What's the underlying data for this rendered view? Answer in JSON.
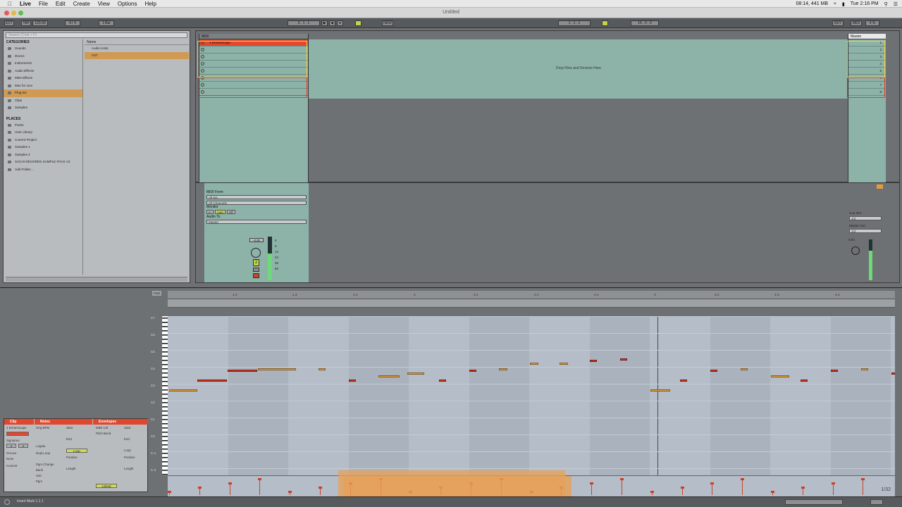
{
  "menubar": {
    "app": "Live",
    "items": [
      "File",
      "Edit",
      "Create",
      "View",
      "Options",
      "Help"
    ],
    "status_cpu": "08:14, 441 MB",
    "clock": "Tue 2:16 PM"
  },
  "window": {
    "title": "Untitled"
  },
  "transport": {
    "ext": "EXT",
    "tap": "TAP",
    "tempo": "120.00",
    "meter": "4 / 4",
    "quant": "1 Bar",
    "position": "3 . 1 . 1",
    "new": "NEW",
    "loop_start": "1 . 1 . 1",
    "loop_len": "16 . 0 . 0",
    "key": "KEY",
    "midi": "MIDI",
    "cpu": "4 %"
  },
  "browser": {
    "search_placeholder": "Search (Cmd + F)",
    "categories_title": "CATEGORIES",
    "categories": [
      "Sounds",
      "Drums",
      "Instruments",
      "Audio Effects",
      "MIDI Effects",
      "Max for Live",
      "Plug-ins",
      "Clips",
      "Samples"
    ],
    "selected_category": "Plug-ins",
    "places_title": "PLACES",
    "places": [
      "Packs",
      "User Library",
      "Current Project",
      "Samples 1",
      "Samples 2",
      "SACHI RECORDS SAMPLE PACK V2",
      "Add Folder..."
    ],
    "name_header": "Name",
    "names": [
      "Audio Units",
      "VST"
    ],
    "selected_name": "VST"
  },
  "session": {
    "track_name": "MIDI",
    "clip_name": "1 Dreamscape",
    "drop_text": "Drop Files and Devices Here",
    "master_name": "Master",
    "scenes": [
      "1",
      "2",
      "3",
      "4",
      "5",
      "6",
      "7",
      "8"
    ]
  },
  "mixer": {
    "midi_from_label": "MIDI From",
    "midi_from": "All Ins",
    "channel": "All Channels",
    "monitor_label": "Monitor",
    "monitor_in": "In",
    "monitor_auto": "Auto",
    "monitor_off": "Off",
    "audio_to_label": "Audio To",
    "audio_to": "Master",
    "volume": "-0.00",
    "track_number": "2",
    "meter_scale": [
      "0",
      "6",
      "12",
      "24",
      "36",
      "60"
    ],
    "cue_out_label": "Cue Out",
    "cue_out": "1/2",
    "master_out_label": "Master Out",
    "master_out": "1/2",
    "master_volume": "0.00"
  },
  "clipview": {
    "clip_tab": "Clip",
    "notes_tab": "Notes",
    "envelopes_tab": "Envelopes",
    "clip_name": "1 Dreamscape",
    "signature_label": "Signature",
    "sig_num": "4",
    "sig_den": "4",
    "groove_label": "Groove",
    "groove_value": "None",
    "commit": "Commit",
    "orig_bpm": "Orig BPM",
    "legato": "Legato",
    "dupl_loop": "Dupl.Loop",
    "pgm_change": "Pgm Change",
    "bank": "Bank",
    "sub": "Sub",
    "pgm": "Pgm",
    "start": "Start",
    "end": "End",
    "loop": "Loop",
    "position": "Position",
    "length": "Length",
    "linked": "Linked",
    "device_chooser": "MIDI Ctrl",
    "control_chooser": "Pitch Bend",
    "fold": "Fold"
  },
  "ruler": {
    "ticks": [
      "1.2",
      "1.3",
      "1.4",
      "2",
      "2.2",
      "2.3",
      "2.4",
      "3",
      "3.2",
      "3.3",
      "3.4"
    ],
    "octaves": [
      "C7",
      "C6",
      "C5",
      "C4",
      "C3",
      "C2",
      "C1",
      "C0",
      "C-1",
      "C-2"
    ],
    "fraction": "1/32"
  },
  "status_bar": {
    "text": "Insert Mark 1.1.1"
  }
}
